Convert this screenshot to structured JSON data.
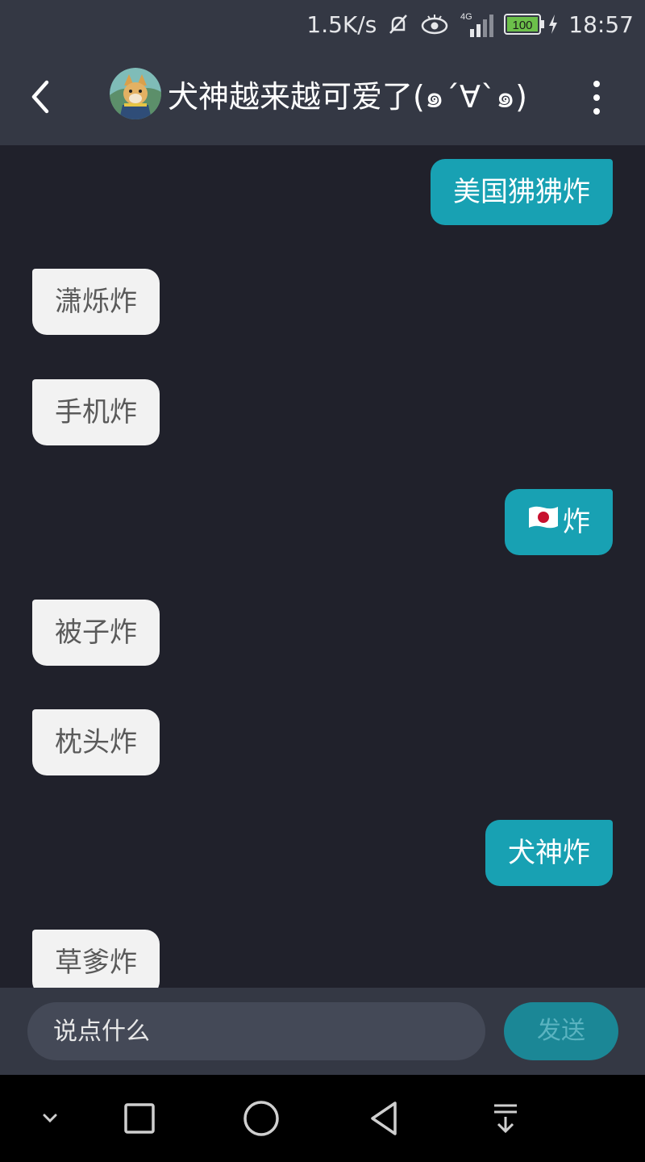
{
  "status_bar": {
    "network_speed": "1.5K/s",
    "network_type": "4G",
    "battery": "100",
    "time": "18:57",
    "icons": [
      "mute-icon",
      "eye-icon",
      "signal-icon",
      "battery-icon",
      "charging-icon"
    ]
  },
  "header": {
    "title": "犬神越来越可爱了(๑´∀`๑)",
    "back_icon": "chevron-left-icon",
    "more_icon": "more-vertical-icon"
  },
  "messages": [
    {
      "side": "out",
      "text": "美国狒狒炸"
    },
    {
      "side": "in",
      "text": "潇烁炸"
    },
    {
      "side": "in",
      "text": "手机炸"
    },
    {
      "side": "out",
      "text": "炸",
      "prefix_icon": "japan-flag-icon"
    },
    {
      "side": "in",
      "text": "被子炸"
    },
    {
      "side": "in",
      "text": "枕头炸"
    },
    {
      "side": "out",
      "text": "犬神炸"
    },
    {
      "side": "in",
      "text": "草爹炸"
    }
  ],
  "composer": {
    "placeholder": "说点什么",
    "value": "",
    "send_label": "发送"
  },
  "nav_bar": {
    "icons": [
      "collapse-icon",
      "recents-icon",
      "home-icon",
      "back-icon",
      "notification-pull-icon"
    ]
  },
  "colors": {
    "chat_bg": "#20212b",
    "bar_bg": "#343844",
    "outgoing_bubble": "#18a1b3",
    "incoming_bubble": "#f2f2f2",
    "send_button": "#1b8796"
  }
}
